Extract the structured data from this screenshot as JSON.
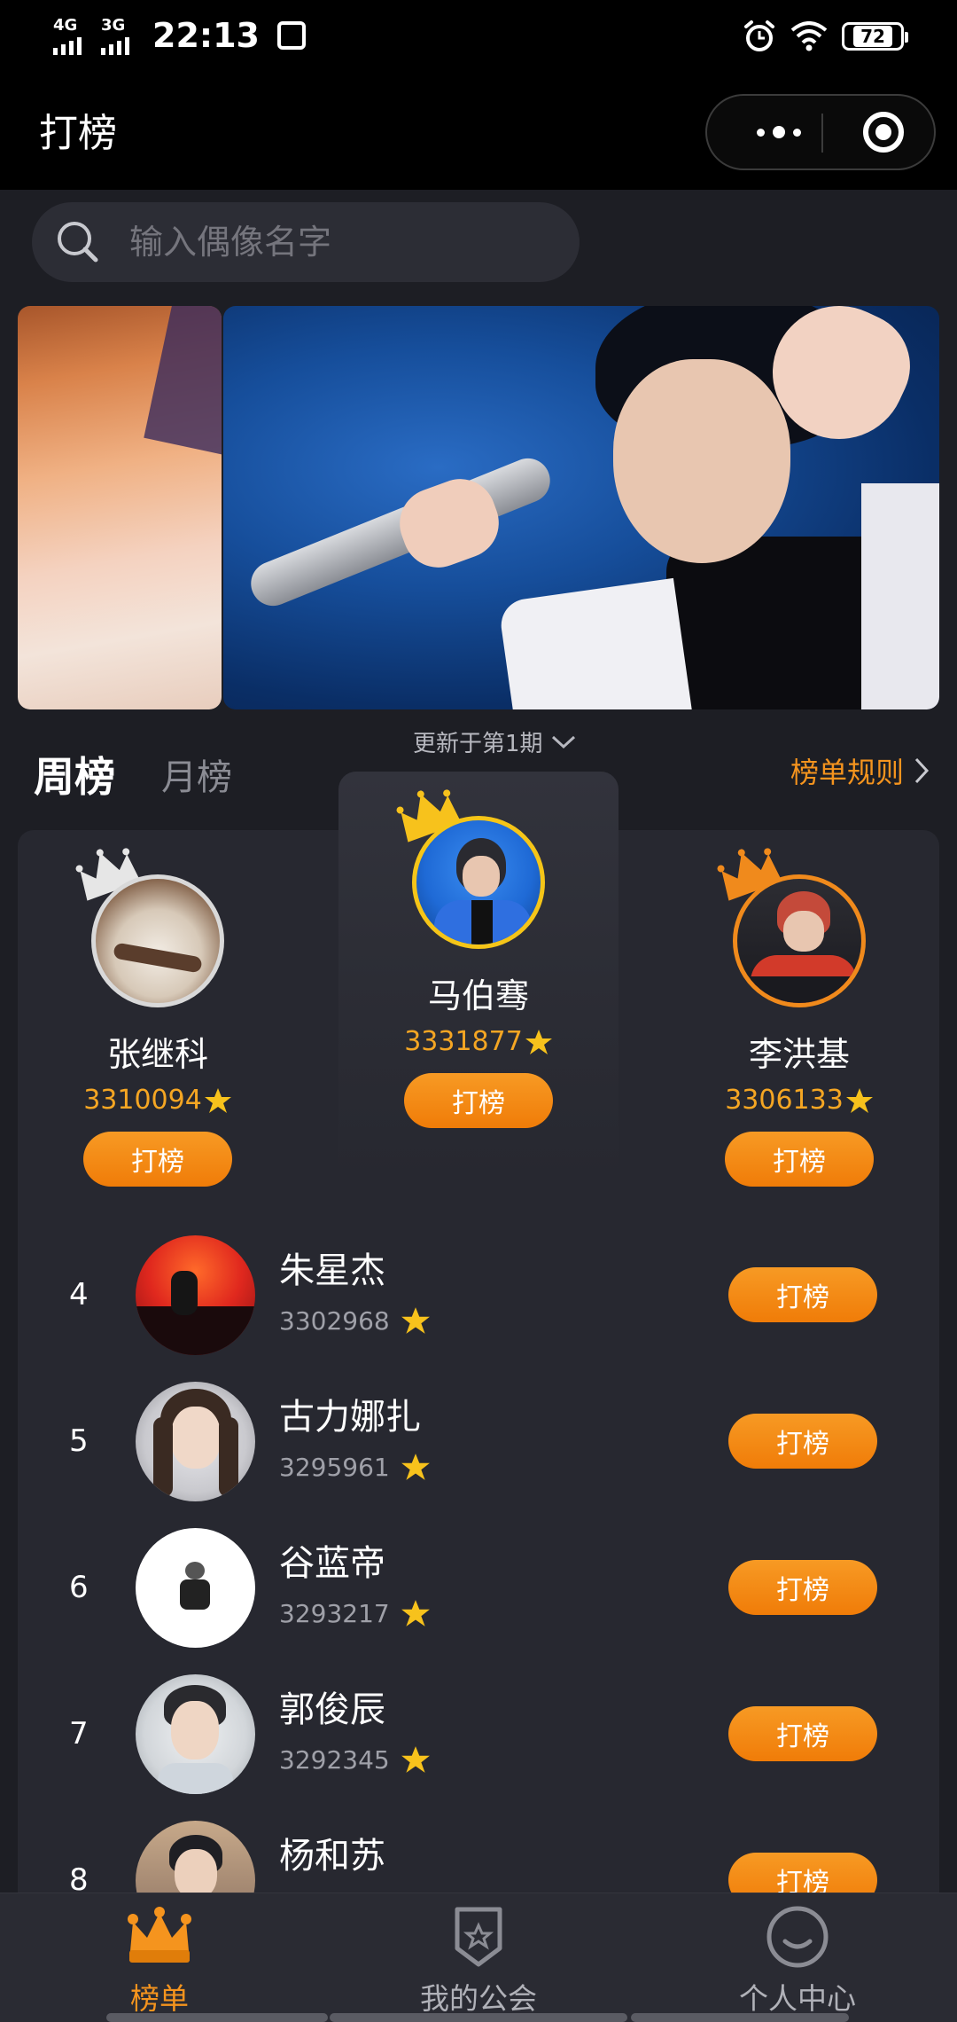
{
  "status_bar": {
    "network1": "4G",
    "network2": "3G",
    "time": "22:13",
    "battery": "72"
  },
  "nav": {
    "title": "打榜"
  },
  "search": {
    "placeholder": "输入偶像名字"
  },
  "tabs": {
    "weekly": "周榜",
    "monthly": "月榜",
    "update": "更新于第1期",
    "rules": "榜单规则"
  },
  "top3": [
    {
      "rank": 2,
      "name": "张继科",
      "score": "3310094",
      "button": "打榜",
      "ring": "#d9d9d9",
      "crown": "silver"
    },
    {
      "rank": 1,
      "name": "马伯骞",
      "score": "3331877",
      "button": "打榜",
      "ring": "#f5c518",
      "crown": "gold"
    },
    {
      "rank": 3,
      "name": "李洪基",
      "score": "3306133",
      "button": "打榜",
      "ring": "#f08a1c",
      "crown": "bronze"
    }
  ],
  "list": [
    {
      "rank": "4",
      "name": "朱星杰",
      "score": "3302968",
      "button": "打榜"
    },
    {
      "rank": "5",
      "name": "古力娜扎",
      "score": "3295961",
      "button": "打榜"
    },
    {
      "rank": "6",
      "name": "谷蓝帝",
      "score": "3293217",
      "button": "打榜"
    },
    {
      "rank": "7",
      "name": "郭俊辰",
      "score": "3292345",
      "button": "打榜"
    },
    {
      "rank": "8",
      "name": "杨和苏",
      "score": "",
      "button": "打榜"
    }
  ],
  "tabbar": [
    {
      "label": "榜单",
      "icon": "crown-icon",
      "active": true
    },
    {
      "label": "我的公会",
      "icon": "guild-badge-icon",
      "active": false
    },
    {
      "label": "个人中心",
      "icon": "profile-smile-icon",
      "active": false
    }
  ],
  "colors": {
    "accent": "#f5941e",
    "background": "#1d1e24",
    "card": "#272830",
    "score_gold": "#f5a623"
  }
}
